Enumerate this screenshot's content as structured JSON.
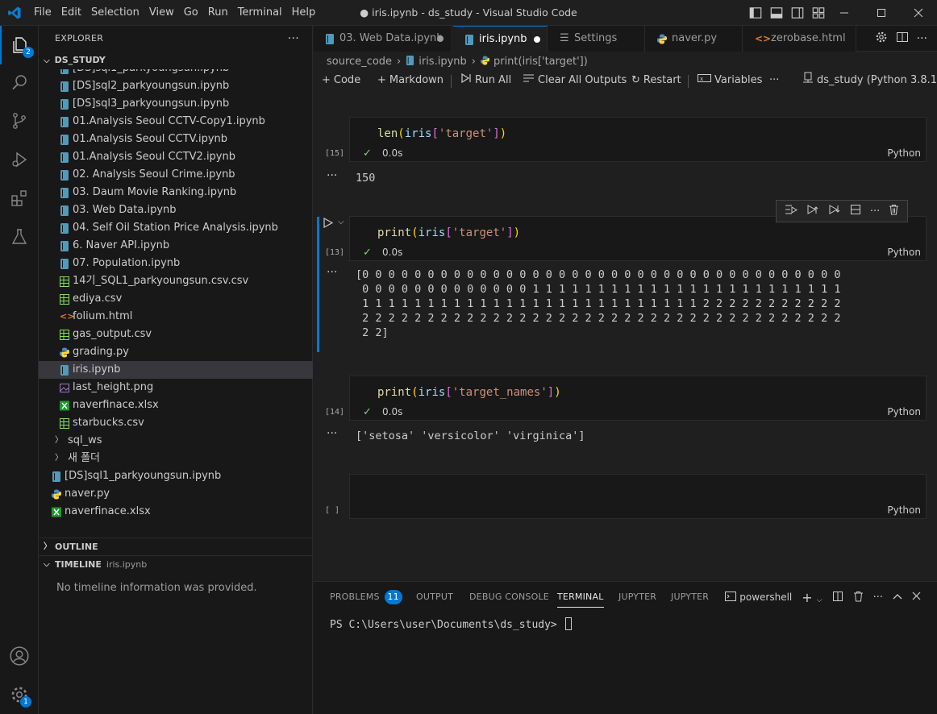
{
  "window": {
    "title": "● iris.ipynb - ds_study - Visual Studio Code",
    "menu": [
      "File",
      "Edit",
      "Selection",
      "View",
      "Go",
      "Run",
      "Terminal",
      "Help"
    ]
  },
  "activity_bar": {
    "explorer_badge": "2",
    "manage_badge": "1"
  },
  "sidebar": {
    "header": "EXPLORER",
    "more": "···",
    "folder": "DS_STUDY",
    "items": [
      {
        "label": "[DS]sql1_parkyoungsun.ipynb",
        "type": "notebook"
      },
      {
        "label": "[DS]sql2_parkyoungsun.ipynb",
        "type": "notebook"
      },
      {
        "label": "[DS]sql3_parkyoungsun.ipynb",
        "type": "notebook"
      },
      {
        "label": "01.Analysis Seoul CCTV-Copy1.ipynb",
        "type": "notebook"
      },
      {
        "label": "01.Analysis Seoul CCTV.ipynb",
        "type": "notebook"
      },
      {
        "label": "01.Analysis Seoul CCTV2.ipynb",
        "type": "notebook"
      },
      {
        "label": "02. Analysis Seoul Crime.ipynb",
        "type": "notebook"
      },
      {
        "label": "03. Daum Movie Ranking.ipynb",
        "type": "notebook"
      },
      {
        "label": "03. Web Data.ipynb",
        "type": "notebook"
      },
      {
        "label": "04. Self Oil Station Price Analysis.ipynb",
        "type": "notebook"
      },
      {
        "label": "6. Naver API.ipynb",
        "type": "notebook"
      },
      {
        "label": "07. Population.ipynb",
        "type": "notebook"
      },
      {
        "label": "14기_SQL1_parkyoungsun.csv.csv",
        "type": "csv"
      },
      {
        "label": "ediya.csv",
        "type": "csv"
      },
      {
        "label": "folium.html",
        "type": "html"
      },
      {
        "label": "gas_output.csv",
        "type": "csv"
      },
      {
        "label": "grading.py",
        "type": "python"
      },
      {
        "label": "iris.ipynb",
        "type": "notebook",
        "selected": true
      },
      {
        "label": "last_height.png",
        "type": "image"
      },
      {
        "label": "naverfinace.xlsx",
        "type": "excel"
      },
      {
        "label": "starbucks.csv",
        "type": "csv"
      },
      {
        "label": "sql_ws",
        "type": "folder"
      },
      {
        "label": "새 폴더",
        "type": "folder"
      },
      {
        "label": "[DS]sql1_parkyoungsun.ipynb",
        "type": "notebook"
      },
      {
        "label": "naver.py",
        "type": "python"
      },
      {
        "label": "naverfinace.xlsx",
        "type": "excel"
      }
    ],
    "outline": "OUTLINE",
    "timeline": "TIMELINE",
    "timeline_file": "iris.ipynb",
    "timeline_message": "No timeline information was provided."
  },
  "tabs": [
    {
      "label": "03. Web Data.ipynb",
      "type": "notebook",
      "dirty": true
    },
    {
      "label": "iris.ipynb",
      "type": "notebook",
      "dirty": true,
      "active": true
    },
    {
      "label": "Settings",
      "type": "settings"
    },
    {
      "label": "naver.py",
      "type": "python"
    },
    {
      "label": "zerobase.html",
      "type": "html"
    }
  ],
  "breadcrumb": [
    "source_code",
    "iris.ipynb",
    "print(iris['target'])"
  ],
  "toolbar": {
    "code": "Code",
    "markdown": "Markdown",
    "run_all": "Run All",
    "clear_outputs": "Clear All Outputs",
    "restart": "Restart",
    "variables": "Variables",
    "more": "···",
    "kernel": "ds_study (Python 3.8.16)"
  },
  "cells": [
    {
      "exec": "[15]",
      "code_fn": "len",
      "code_open": "(",
      "code_var": "iris",
      "code_bo": "[",
      "code_str": "'target'",
      "code_bc": "]",
      "code_close": ")",
      "time": "0.0s",
      "lang": "Python",
      "output": "150"
    },
    {
      "exec": "[13]",
      "code_fn": "print",
      "code_open": "(",
      "code_var": "iris",
      "code_bo": "[",
      "code_str": "'target'",
      "code_bc": "]",
      "code_close": ")",
      "time": "0.0s",
      "lang": "Python",
      "output": "[0 0 0 0 0 0 0 0 0 0 0 0 0 0 0 0 0 0 0 0 0 0 0 0 0 0 0 0 0 0 0 0 0 0 0 0 0\n 0 0 0 0 0 0 0 0 0 0 0 0 0 1 1 1 1 1 1 1 1 1 1 1 1 1 1 1 1 1 1 1 1 1 1 1 1\n 1 1 1 1 1 1 1 1 1 1 1 1 1 1 1 1 1 1 1 1 1 1 1 1 1 1 2 2 2 2 2 2 2 2 2 2 2\n 2 2 2 2 2 2 2 2 2 2 2 2 2 2 2 2 2 2 2 2 2 2 2 2 2 2 2 2 2 2 2 2 2 2 2 2 2\n 2 2]"
    },
    {
      "exec": "[14]",
      "code_fn": "print",
      "code_open": "(",
      "code_var": "iris",
      "code_bo": "[",
      "code_str": "'target_names'",
      "code_bc": "]",
      "code_close": ")",
      "time": "0.0s",
      "lang": "Python",
      "output": "['setosa' 'versicolor' 'virginica']"
    },
    {
      "exec": "[ ]",
      "lang": "Python"
    }
  ],
  "output_marker": "···",
  "panel": {
    "tabs": [
      "PROBLEMS",
      "OUTPUT",
      "DEBUG CONSOLE",
      "TERMINAL",
      "JUPYTER",
      "JUPYTER"
    ],
    "problems_count": "11",
    "active_tab": "TERMINAL",
    "shell": "powershell",
    "prompt": "PS C:\\Users\\user\\Documents\\ds_study> "
  },
  "colors": {
    "accent": "#0078d4",
    "notebook_icon": "#519aba",
    "csv_icon": "#89e051",
    "html_icon": "#e37933",
    "python_icon": "#3572a5",
    "image_icon": "#a074c4",
    "excel_icon": "#209a30"
  }
}
